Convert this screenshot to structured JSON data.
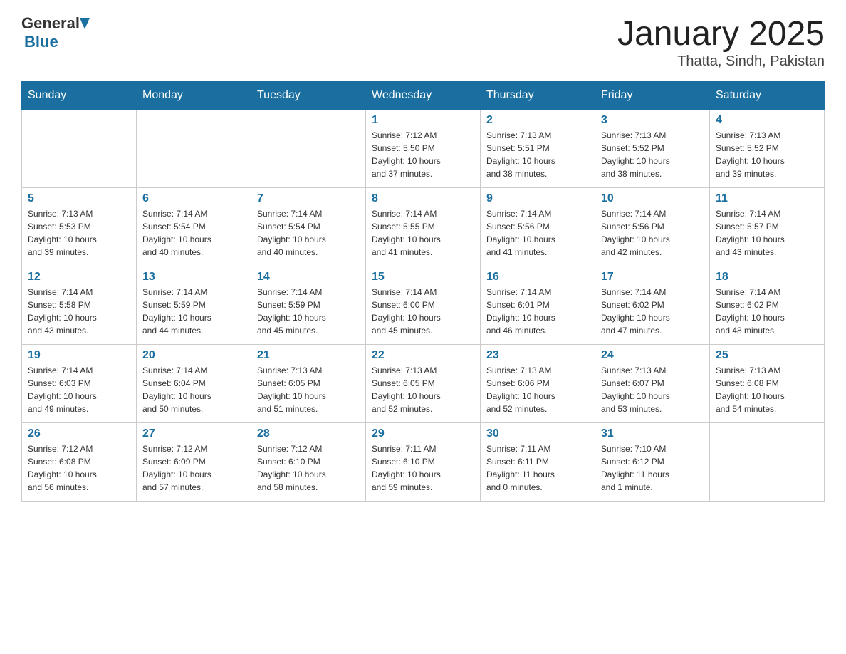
{
  "header": {
    "logo_general": "General",
    "logo_blue": "Blue",
    "title": "January 2025",
    "subtitle": "Thatta, Sindh, Pakistan"
  },
  "days_of_week": [
    "Sunday",
    "Monday",
    "Tuesday",
    "Wednesday",
    "Thursday",
    "Friday",
    "Saturday"
  ],
  "weeks": [
    [
      {
        "day": "",
        "info": ""
      },
      {
        "day": "",
        "info": ""
      },
      {
        "day": "",
        "info": ""
      },
      {
        "day": "1",
        "info": "Sunrise: 7:12 AM\nSunset: 5:50 PM\nDaylight: 10 hours\nand 37 minutes."
      },
      {
        "day": "2",
        "info": "Sunrise: 7:13 AM\nSunset: 5:51 PM\nDaylight: 10 hours\nand 38 minutes."
      },
      {
        "day": "3",
        "info": "Sunrise: 7:13 AM\nSunset: 5:52 PM\nDaylight: 10 hours\nand 38 minutes."
      },
      {
        "day": "4",
        "info": "Sunrise: 7:13 AM\nSunset: 5:52 PM\nDaylight: 10 hours\nand 39 minutes."
      }
    ],
    [
      {
        "day": "5",
        "info": "Sunrise: 7:13 AM\nSunset: 5:53 PM\nDaylight: 10 hours\nand 39 minutes."
      },
      {
        "day": "6",
        "info": "Sunrise: 7:14 AM\nSunset: 5:54 PM\nDaylight: 10 hours\nand 40 minutes."
      },
      {
        "day": "7",
        "info": "Sunrise: 7:14 AM\nSunset: 5:54 PM\nDaylight: 10 hours\nand 40 minutes."
      },
      {
        "day": "8",
        "info": "Sunrise: 7:14 AM\nSunset: 5:55 PM\nDaylight: 10 hours\nand 41 minutes."
      },
      {
        "day": "9",
        "info": "Sunrise: 7:14 AM\nSunset: 5:56 PM\nDaylight: 10 hours\nand 41 minutes."
      },
      {
        "day": "10",
        "info": "Sunrise: 7:14 AM\nSunset: 5:56 PM\nDaylight: 10 hours\nand 42 minutes."
      },
      {
        "day": "11",
        "info": "Sunrise: 7:14 AM\nSunset: 5:57 PM\nDaylight: 10 hours\nand 43 minutes."
      }
    ],
    [
      {
        "day": "12",
        "info": "Sunrise: 7:14 AM\nSunset: 5:58 PM\nDaylight: 10 hours\nand 43 minutes."
      },
      {
        "day": "13",
        "info": "Sunrise: 7:14 AM\nSunset: 5:59 PM\nDaylight: 10 hours\nand 44 minutes."
      },
      {
        "day": "14",
        "info": "Sunrise: 7:14 AM\nSunset: 5:59 PM\nDaylight: 10 hours\nand 45 minutes."
      },
      {
        "day": "15",
        "info": "Sunrise: 7:14 AM\nSunset: 6:00 PM\nDaylight: 10 hours\nand 45 minutes."
      },
      {
        "day": "16",
        "info": "Sunrise: 7:14 AM\nSunset: 6:01 PM\nDaylight: 10 hours\nand 46 minutes."
      },
      {
        "day": "17",
        "info": "Sunrise: 7:14 AM\nSunset: 6:02 PM\nDaylight: 10 hours\nand 47 minutes."
      },
      {
        "day": "18",
        "info": "Sunrise: 7:14 AM\nSunset: 6:02 PM\nDaylight: 10 hours\nand 48 minutes."
      }
    ],
    [
      {
        "day": "19",
        "info": "Sunrise: 7:14 AM\nSunset: 6:03 PM\nDaylight: 10 hours\nand 49 minutes."
      },
      {
        "day": "20",
        "info": "Sunrise: 7:14 AM\nSunset: 6:04 PM\nDaylight: 10 hours\nand 50 minutes."
      },
      {
        "day": "21",
        "info": "Sunrise: 7:13 AM\nSunset: 6:05 PM\nDaylight: 10 hours\nand 51 minutes."
      },
      {
        "day": "22",
        "info": "Sunrise: 7:13 AM\nSunset: 6:05 PM\nDaylight: 10 hours\nand 52 minutes."
      },
      {
        "day": "23",
        "info": "Sunrise: 7:13 AM\nSunset: 6:06 PM\nDaylight: 10 hours\nand 52 minutes."
      },
      {
        "day": "24",
        "info": "Sunrise: 7:13 AM\nSunset: 6:07 PM\nDaylight: 10 hours\nand 53 minutes."
      },
      {
        "day": "25",
        "info": "Sunrise: 7:13 AM\nSunset: 6:08 PM\nDaylight: 10 hours\nand 54 minutes."
      }
    ],
    [
      {
        "day": "26",
        "info": "Sunrise: 7:12 AM\nSunset: 6:08 PM\nDaylight: 10 hours\nand 56 minutes."
      },
      {
        "day": "27",
        "info": "Sunrise: 7:12 AM\nSunset: 6:09 PM\nDaylight: 10 hours\nand 57 minutes."
      },
      {
        "day": "28",
        "info": "Sunrise: 7:12 AM\nSunset: 6:10 PM\nDaylight: 10 hours\nand 58 minutes."
      },
      {
        "day": "29",
        "info": "Sunrise: 7:11 AM\nSunset: 6:10 PM\nDaylight: 10 hours\nand 59 minutes."
      },
      {
        "day": "30",
        "info": "Sunrise: 7:11 AM\nSunset: 6:11 PM\nDaylight: 11 hours\nand 0 minutes."
      },
      {
        "day": "31",
        "info": "Sunrise: 7:10 AM\nSunset: 6:12 PM\nDaylight: 11 hours\nand 1 minute."
      },
      {
        "day": "",
        "info": ""
      }
    ]
  ]
}
